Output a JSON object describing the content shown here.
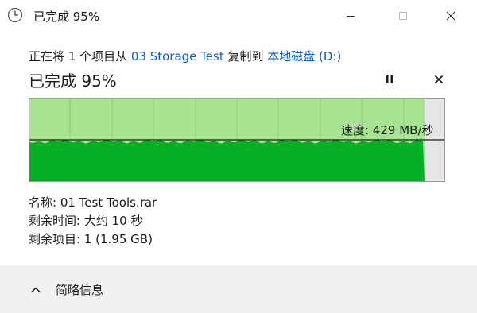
{
  "window": {
    "title": "已完成 95%"
  },
  "header": {
    "prefix": "正在将 1 个项目从 ",
    "source": "03 Storage Test",
    "middle": " 复制到 ",
    "destination": "本地磁盘 (D:)"
  },
  "progress": {
    "title": "已完成 95%",
    "percent": 95
  },
  "graph": {
    "speed_text": "速度: 429 MB/秒",
    "colors": {
      "background": "#e6e6e6",
      "completed": "#a6e491",
      "throughput": "#06b025",
      "grid": "#8bcf78"
    }
  },
  "details": {
    "name": "名称: 01 Test Tools.rar",
    "time_remaining": "剩余时间: 大约 10 秒",
    "items_remaining": "剩余项目: 1 (1.95 GB)"
  },
  "footer": {
    "toggle_label": "简略信息"
  },
  "icons": {
    "title": "clock-icon",
    "pause": "pause-icon",
    "cancel": "close-icon",
    "toggle": "chevron-up-icon"
  }
}
